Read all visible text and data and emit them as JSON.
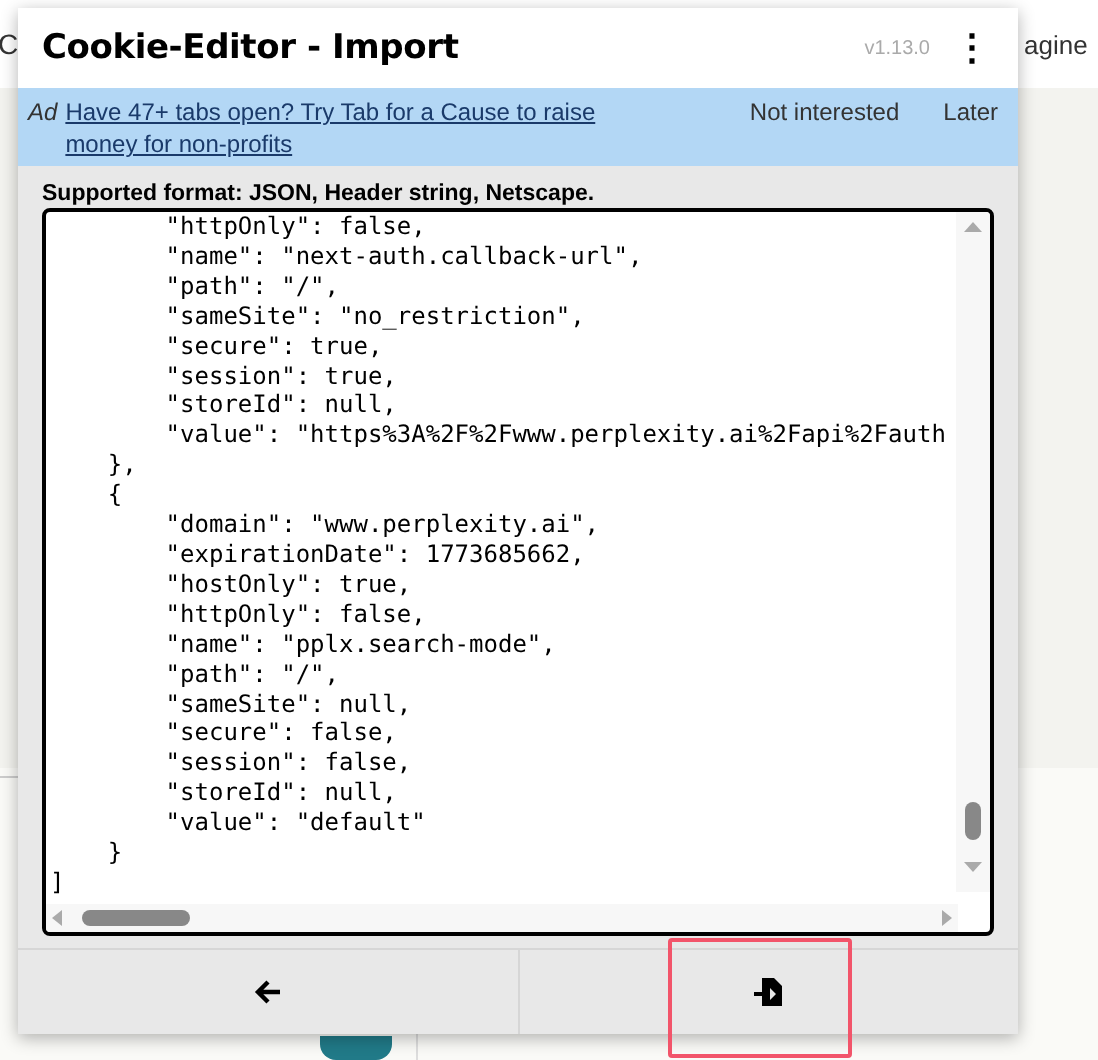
{
  "background_page": {
    "texts": [
      "C",
      "agine"
    ]
  },
  "popup": {
    "title": "Cookie-Editor - Import",
    "version": "v1.13.0",
    "menu_icon": "⋮"
  },
  "ad": {
    "tag": "Ad",
    "link": "Have 47+ tabs open? Try Tab for a Cause to raise money for non-profits",
    "actions": [
      "Not interested",
      "Later"
    ]
  },
  "import_form": {
    "label": "Supported format: JSON, Header string, Netscape.",
    "value": "        \"httpOnly\": false,\n        \"name\": \"next-auth.callback-url\",\n        \"path\": \"/\",\n        \"sameSite\": \"no_restriction\",\n        \"secure\": true,\n        \"session\": true,\n        \"storeId\": null,\n        \"value\": \"https%3A%2F%2Fwww.perplexity.ai%2Fapi%2Fauth\n    },\n    {\n        \"domain\": \"www.perplexity.ai\",\n        \"expirationDate\": 1773685662,\n        \"hostOnly\": true,\n        \"httpOnly\": false,\n        \"name\": \"pplx.search-mode\",\n        \"path\": \"/\",\n        \"sameSite\": null,\n        \"secure\": false,\n        \"session\": false,\n        \"storeId\": null,\n        \"value\": \"default\"\n    }\n]"
  },
  "footer_buttons": [
    {
      "kind": "back",
      "highlighted": false
    },
    {
      "kind": "import",
      "highlighted": true
    }
  ]
}
